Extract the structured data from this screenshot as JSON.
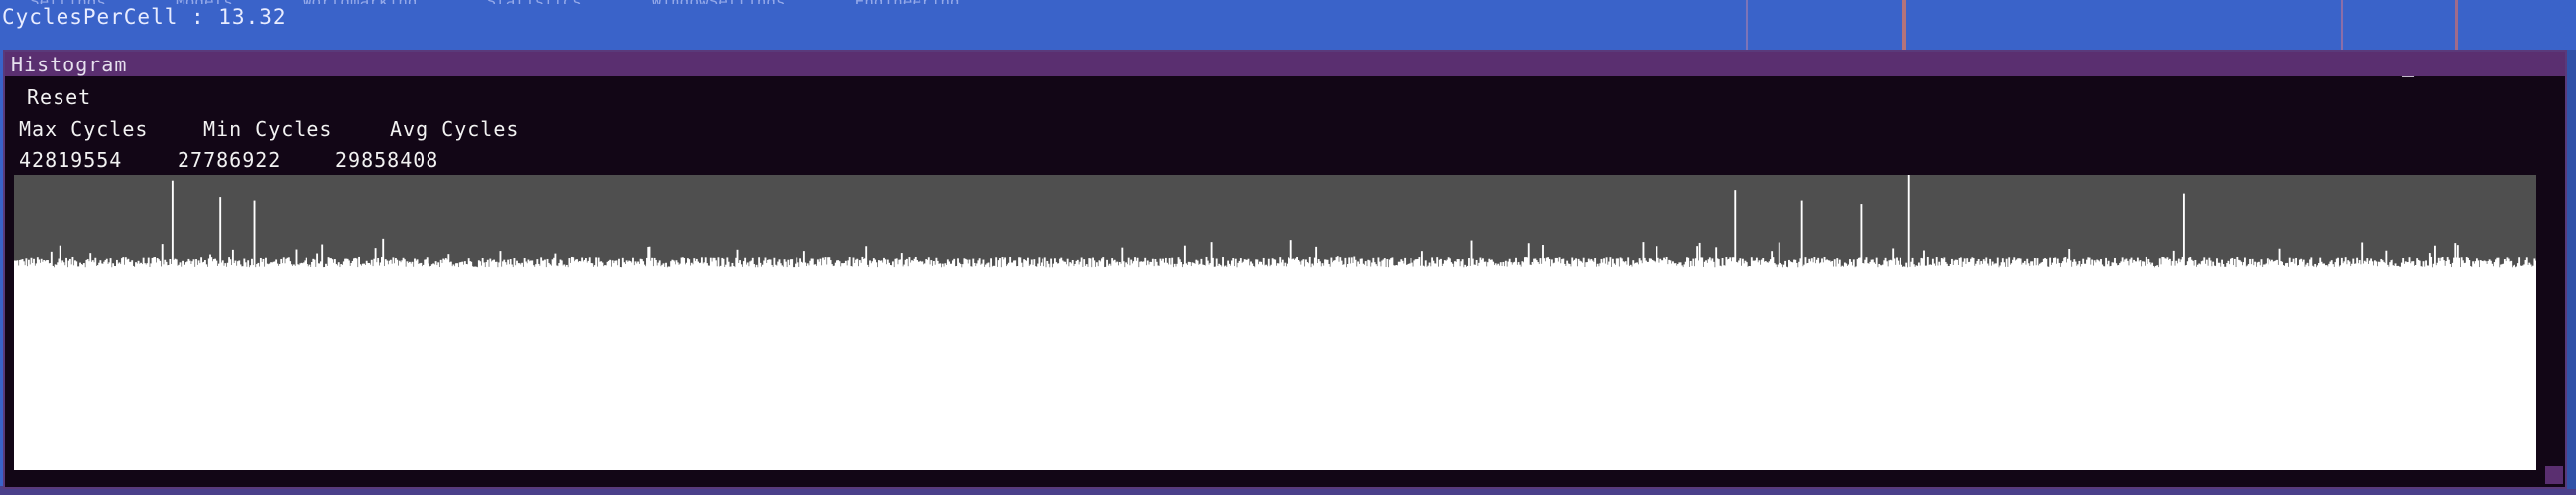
{
  "status": {
    "cycles_per_cell": "CyclesPerCell : 13.32"
  },
  "top_menu_fragments": [
    "Settings",
    "Models",
    "Worldmarking",
    "Statistics",
    "WindowSettings",
    "Engineering"
  ],
  "window": {
    "title": "Histogram",
    "minimize_label": "_",
    "reset_label": "Reset"
  },
  "stats": {
    "max_label": "Max Cycles",
    "min_label": "Min Cycles",
    "avg_label": "Avg Cycles",
    "max_value": "42819554",
    "min_value": "27786922",
    "avg_value": "29858408"
  },
  "colors": {
    "background": "#3a63c9",
    "window_body": "#120616",
    "title_bar": "#5a2f70",
    "plot_background": "#4f4f4f",
    "bars": "#ffffff"
  },
  "chart_data": {
    "type": "bar",
    "series_count": 2000,
    "y_min": 0,
    "y_max": 42819554,
    "baseline_avg": 29858408,
    "spikes": [
      {
        "index": 125,
        "value": 42000000
      },
      {
        "index": 163,
        "value": 39500000
      },
      {
        "index": 190,
        "value": 39000000
      },
      {
        "index": 1364,
        "value": 40500000
      },
      {
        "index": 1417,
        "value": 39000000
      },
      {
        "index": 1464,
        "value": 38500000
      },
      {
        "index": 1502,
        "value": 42819554
      },
      {
        "index": 1720,
        "value": 40000000
      }
    ]
  }
}
